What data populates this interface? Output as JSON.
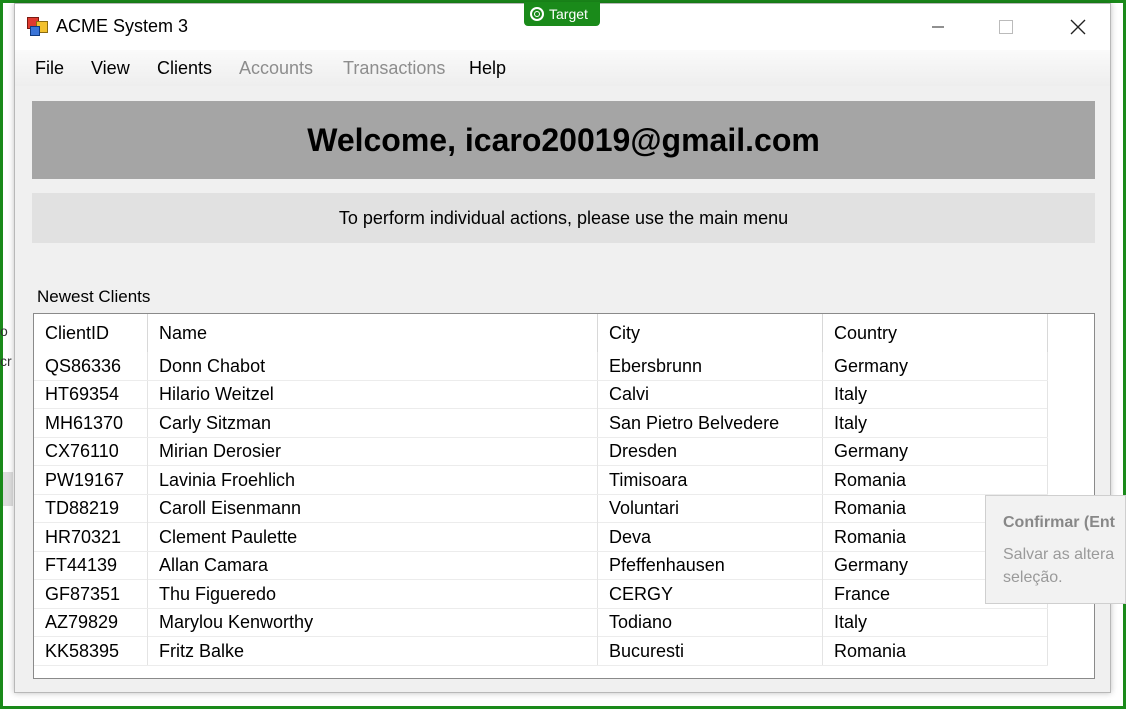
{
  "overlay": {
    "target_label": "Target",
    "accent_color": "#1a8a1a",
    "background_fragments": [
      "o",
      "cr"
    ]
  },
  "window": {
    "title": "ACME System 3",
    "icon": "app-icon",
    "controls": {
      "minimize": "minimize-icon",
      "maximize": "maximize-icon",
      "close": "close-icon"
    }
  },
  "menu": {
    "items": [
      {
        "label": "File",
        "enabled": true
      },
      {
        "label": "View",
        "enabled": true
      },
      {
        "label": "Clients",
        "enabled": true
      },
      {
        "label": "Accounts",
        "enabled": false
      },
      {
        "label": "Transactions",
        "enabled": false
      },
      {
        "label": "Help",
        "enabled": true
      }
    ]
  },
  "banner": {
    "welcome": "Welcome, icaro20019@gmail.com"
  },
  "info": {
    "text": "To perform individual actions, please use the main menu"
  },
  "clients": {
    "label": "Newest Clients",
    "columns": [
      "ClientID",
      "Name",
      "City",
      "Country"
    ],
    "rows": [
      [
        "QS86336",
        "Donn Chabot",
        "Ebersbrunn",
        "Germany"
      ],
      [
        "HT69354",
        "Hilario Weitzel",
        "Calvi",
        "Italy"
      ],
      [
        "MH61370",
        "Carly Sitzman",
        "San Pietro Belvedere",
        "Italy"
      ],
      [
        "CX76110",
        "Mirian Derosier",
        "Dresden",
        "Germany"
      ],
      [
        "PW19167",
        "Lavinia Froehlich",
        "Timisoara",
        "Romania"
      ],
      [
        "TD88219",
        "Caroll Eisenmann",
        "Voluntari",
        "Romania"
      ],
      [
        "HR70321",
        "Clement Paulette",
        "Deva",
        "Romania"
      ],
      [
        "FT44139",
        "Allan Camara",
        "Pfeffenhausen",
        "Germany"
      ],
      [
        "GF87351",
        "Thu Figueredo",
        "CERGY",
        "France"
      ],
      [
        "AZ79829",
        "Marylou Kenworthy",
        "Todiano",
        "Italy"
      ],
      [
        "KK58395",
        "Fritz Balke",
        "Bucuresti",
        "Romania"
      ]
    ]
  },
  "tooltip": {
    "title": "Confirmar (Ent",
    "line1": "Salvar as altera",
    "line2": "seleção."
  }
}
